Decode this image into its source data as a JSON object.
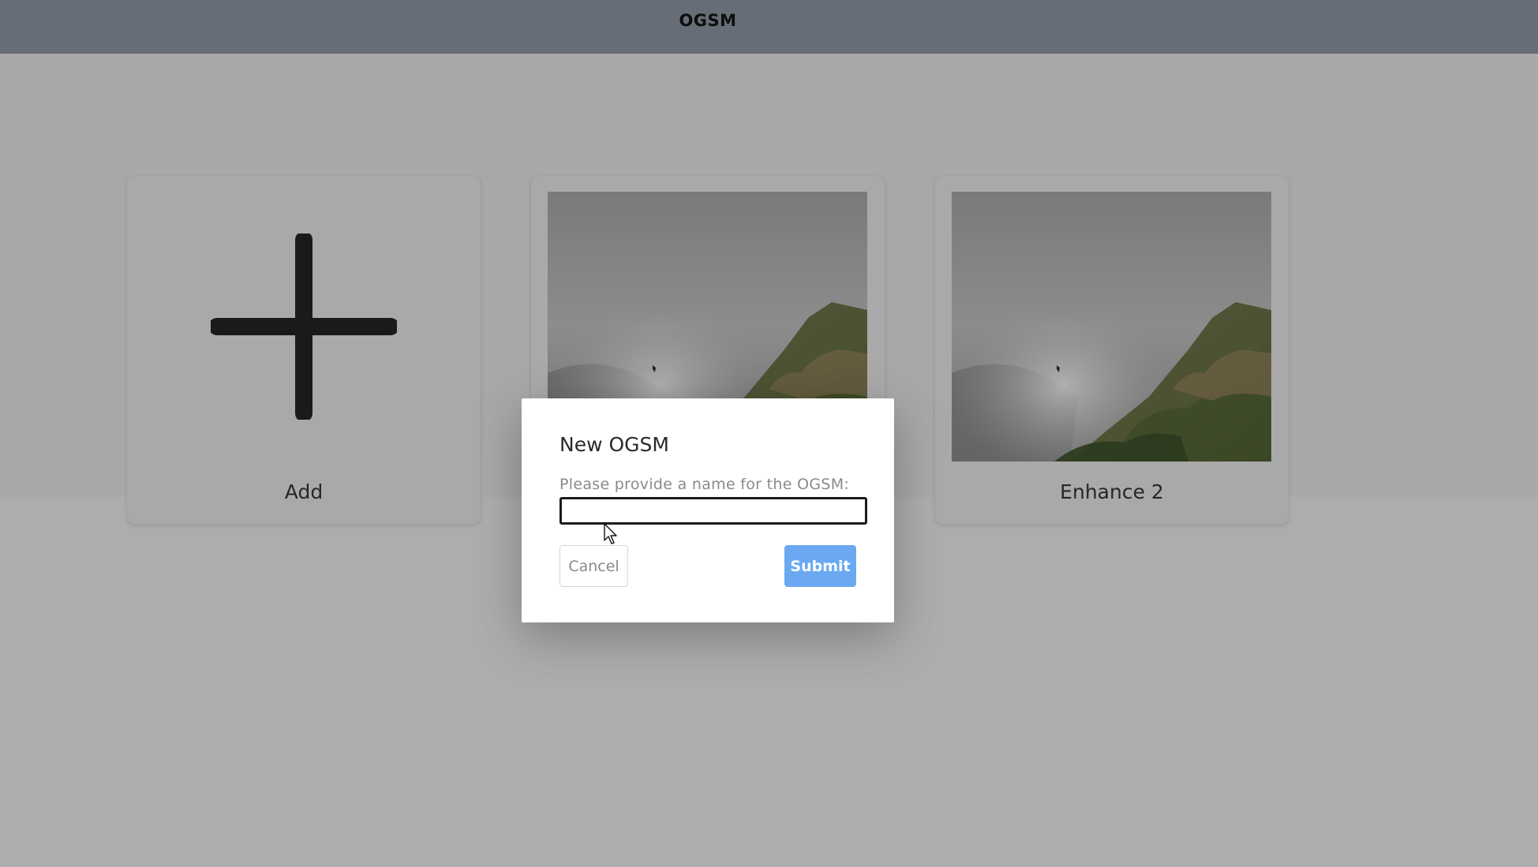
{
  "header": {
    "title": "OGSM"
  },
  "cards": [
    {
      "label": "Add",
      "icon": "plus-icon"
    },
    {
      "label": "",
      "image": "foggy-cliff-thumbnail"
    },
    {
      "label": "Enhance 2",
      "image": "foggy-cliff-thumbnail"
    }
  ],
  "modal": {
    "title": "New OGSM",
    "prompt": "Please provide a name for the OGSM:",
    "input_value": "",
    "cancel_label": "Cancel",
    "submit_label": "Submit"
  },
  "colors": {
    "header_bg": "#676d76",
    "overlay_bg": "#adadad",
    "submit_bg": "#6aa9f2"
  }
}
